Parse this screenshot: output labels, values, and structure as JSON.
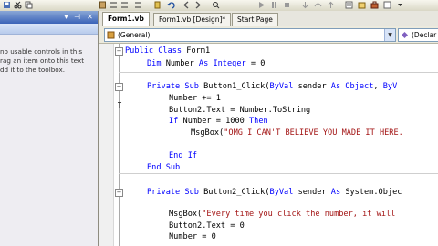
{
  "tabs": [
    {
      "label": "Form1.vb",
      "active": true
    },
    {
      "label": "Form1.vb [Design]*",
      "active": false
    },
    {
      "label": "Start Page",
      "active": false
    }
  ],
  "dropdowns": {
    "class_name": "(General)",
    "method_name": "(Declar"
  },
  "toolbox": {
    "lines": [
      "no usable controls in this",
      "rag an item onto this text",
      "dd it to the toolbox."
    ]
  },
  "code": {
    "l1": [
      "Public Class ",
      "Form1"
    ],
    "l2": [
      "Dim ",
      "Number ",
      "As Integer ",
      "= 0"
    ],
    "l3": [
      "Private Sub ",
      "Button1_Click(",
      "ByVal ",
      "sender ",
      "As Object",
      ", ",
      "ByV"
    ],
    "l4": [
      "Number += 1"
    ],
    "l5": [
      "Button2.Text = Number.ToString"
    ],
    "l6": [
      "If ",
      "Number = 1000 ",
      "Then"
    ],
    "l7": [
      "MsgBox(",
      "\"OMG I CAN'T BELIEVE YOU MADE IT HERE."
    ],
    "l8": [
      "End If"
    ],
    "l9": [
      "End Sub"
    ],
    "l10": [
      "Private Sub ",
      "Button2_Click(",
      "ByVal ",
      "sender ",
      "As ",
      "System.Objec"
    ],
    "l11": [
      "MsgBox(",
      "\"Every time you click the number, it will"
    ],
    "l12": [
      "Button2.Text = 0"
    ],
    "l13": [
      "Number = 0"
    ]
  },
  "colors": {
    "keyword": "#0000ff",
    "string": "#a31515",
    "title_bar": "#3a63b8"
  },
  "icons": [
    "save-icon",
    "cut-icon",
    "copy-icon",
    "undo-icon",
    "align-icon",
    "play-icon",
    "pin-icon",
    "close-icon",
    "class-icon",
    "method-icon"
  ]
}
